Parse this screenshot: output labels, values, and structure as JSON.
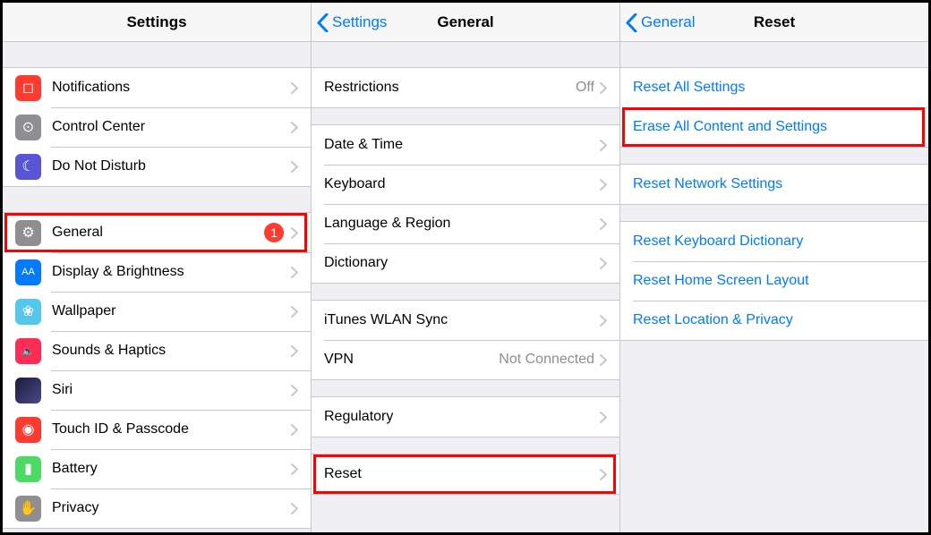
{
  "panel1": {
    "title": "Settings",
    "groups": [
      [
        {
          "key": "notifications",
          "icon": "ic-notifications",
          "glyph": "◻",
          "label": "Notifications"
        },
        {
          "key": "control-center",
          "icon": "ic-control-center",
          "glyph": "⊙",
          "label": "Control Center"
        },
        {
          "key": "dnd",
          "icon": "ic-dnd",
          "glyph": "☾",
          "label": "Do Not Disturb"
        }
      ],
      [
        {
          "key": "general",
          "icon": "ic-general",
          "glyph": "⚙",
          "label": "General",
          "badge": "1",
          "highlighted": true
        },
        {
          "key": "display",
          "icon": "ic-display",
          "glyph": "AA",
          "label": "Display & Brightness"
        },
        {
          "key": "wallpaper",
          "icon": "ic-wallpaper",
          "glyph": "❀",
          "label": "Wallpaper"
        },
        {
          "key": "sounds",
          "icon": "ic-sounds",
          "glyph": "🔈",
          "label": "Sounds & Haptics"
        },
        {
          "key": "siri",
          "icon": "ic-siri",
          "glyph": "",
          "label": "Siri"
        },
        {
          "key": "touchid",
          "icon": "ic-touchid",
          "glyph": "◉",
          "label": "Touch ID & Passcode"
        },
        {
          "key": "battery",
          "icon": "ic-battery",
          "glyph": "▮",
          "label": "Battery"
        },
        {
          "key": "privacy",
          "icon": "ic-privacy",
          "glyph": "✋",
          "label": "Privacy"
        }
      ]
    ]
  },
  "panel2": {
    "back": "Settings",
    "title": "General",
    "groups": [
      [
        {
          "key": "restrictions",
          "label": "Restrictions",
          "detail": "Off"
        }
      ],
      [
        {
          "key": "date-time",
          "label": "Date & Time"
        },
        {
          "key": "keyboard",
          "label": "Keyboard"
        },
        {
          "key": "language-region",
          "label": "Language & Region"
        },
        {
          "key": "dictionary",
          "label": "Dictionary"
        }
      ],
      [
        {
          "key": "itunes-wlan",
          "label": "iTunes WLAN Sync"
        },
        {
          "key": "vpn",
          "label": "VPN",
          "detail": "Not Connected"
        }
      ],
      [
        {
          "key": "regulatory",
          "label": "Regulatory"
        }
      ],
      [
        {
          "key": "reset",
          "label": "Reset",
          "highlighted": true
        }
      ]
    ]
  },
  "panel3": {
    "back": "General",
    "title": "Reset",
    "groups": [
      [
        {
          "key": "reset-all",
          "label": "Reset All Settings",
          "blue": true
        },
        {
          "key": "erase-all",
          "label": "Erase All Content and Settings",
          "blue": true,
          "highlighted": true
        }
      ],
      [
        {
          "key": "reset-network",
          "label": "Reset Network Settings",
          "blue": true
        }
      ],
      [
        {
          "key": "reset-keyboard",
          "label": "Reset Keyboard Dictionary",
          "blue": true
        },
        {
          "key": "reset-home",
          "label": "Reset Home Screen Layout",
          "blue": true
        },
        {
          "key": "reset-location",
          "label": "Reset Location & Privacy",
          "blue": true
        }
      ]
    ]
  }
}
